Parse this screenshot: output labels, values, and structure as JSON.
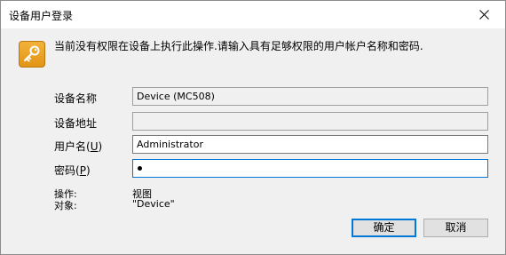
{
  "window": {
    "title": "设备用户登录",
    "message": "当前没有权限在设备上执行此操作.请输入具有足够权限的用户帐户名称和密码."
  },
  "form": {
    "device_name_label": "设备名称",
    "device_name_value": "Device (MC508)",
    "device_address_label": "设备地址",
    "device_address_value": "",
    "username_label": "用户名(U)",
    "username_label_prefix": "用户名(",
    "username_label_key": "U",
    "username_label_suffix": ")",
    "username_value": "Administrator",
    "password_label": "密码(P)",
    "password_label_prefix": "密码(",
    "password_label_key": "P",
    "password_label_suffix": ")",
    "password_mask": "•"
  },
  "info": {
    "operation_label": "操作:",
    "operation_value": "视图",
    "object_label": "对象:",
    "object_value": "\"Device\""
  },
  "buttons": {
    "ok": "确定",
    "cancel": "取消"
  },
  "icons": {
    "close": "close-icon",
    "lock": "key-icon"
  },
  "colors": {
    "focus_border": "#0078d7",
    "icon_orange": "#e39416"
  }
}
